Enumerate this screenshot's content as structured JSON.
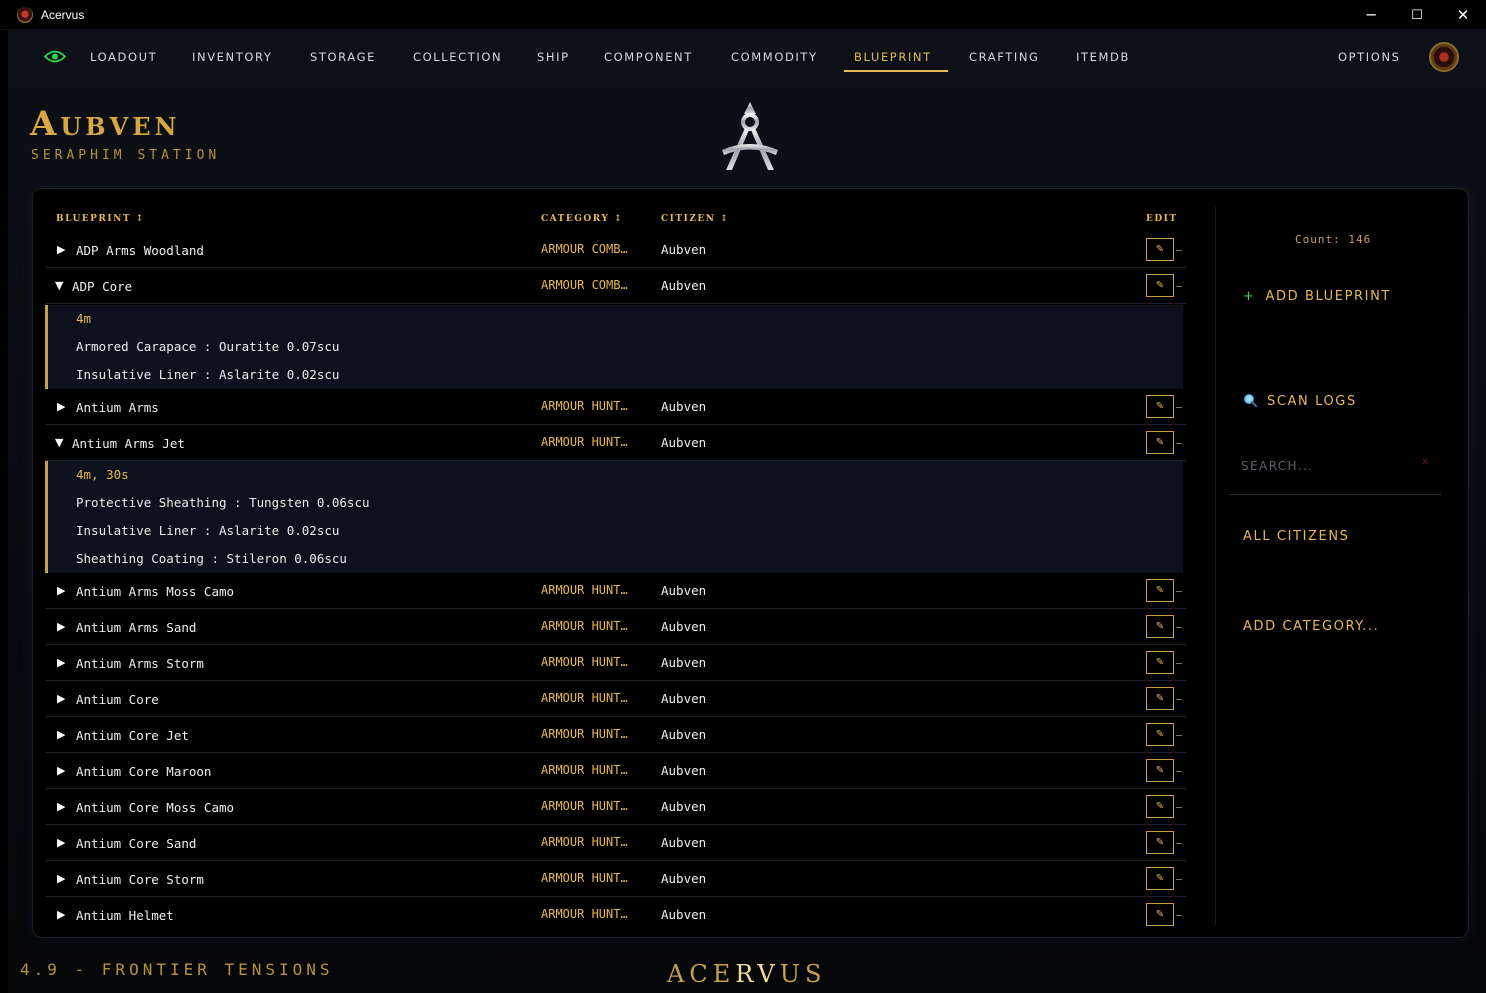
{
  "window": {
    "title": "Acervus",
    "minimize": "─",
    "maximize": "☐",
    "close": "✕"
  },
  "nav": {
    "items": [
      "LOADOUT",
      "INVENTORY",
      "STORAGE",
      "COLLECTION",
      "SHIP",
      "COMPONENT",
      "COMMODITY",
      "BLUEPRINT",
      "CRAFTING",
      "ITEMDB"
    ],
    "active": "BLUEPRINT",
    "options": "OPTIONS"
  },
  "header": {
    "citizen": "Aubven",
    "station": "SERAPHIM STATION"
  },
  "table": {
    "headers": {
      "blueprint": "BLUEPRINT ↕",
      "category": "CATEGORY ↕",
      "citizen": "CITIZEN ↕",
      "edit": "EDIT"
    },
    "rows": [
      {
        "name": "ADP Arms Woodland",
        "category": "ARMOUR COMBAT",
        "citizen": "Aubven",
        "expanded": false
      },
      {
        "name": "ADP Core",
        "category": "ARMOUR COMBAT",
        "citizen": "Aubven",
        "expanded": true,
        "details": {
          "time": "4m",
          "items": [
            "Armored Carapace : Ouratite 0.07scu",
            "Insulative Liner : Aslarite 0.02scu"
          ]
        }
      },
      {
        "name": "Antium Arms",
        "category": "ARMOUR HUNTER",
        "citizen": "Aubven",
        "expanded": false
      },
      {
        "name": "Antium Arms Jet",
        "category": "ARMOUR HUNTER",
        "citizen": "Aubven",
        "expanded": true,
        "details": {
          "time": "4m, 30s",
          "items": [
            "Protective Sheathing : Tungsten 0.06scu",
            "Insulative Liner : Aslarite 0.02scu",
            "Sheathing Coating : Stileron 0.06scu"
          ]
        }
      },
      {
        "name": "Antium Arms Moss Camo",
        "category": "ARMOUR HUNTER",
        "citizen": "Aubven",
        "expanded": false
      },
      {
        "name": "Antium Arms Sand",
        "category": "ARMOUR HUNTER",
        "citizen": "Aubven",
        "expanded": false
      },
      {
        "name": "Antium Arms Storm",
        "category": "ARMOUR HUNTER",
        "citizen": "Aubven",
        "expanded": false
      },
      {
        "name": "Antium Core",
        "category": "ARMOUR HUNTER",
        "citizen": "Aubven",
        "expanded": false
      },
      {
        "name": "Antium Core Jet",
        "category": "ARMOUR HUNTER",
        "citizen": "Aubven",
        "expanded": false
      },
      {
        "name": "Antium Core Maroon",
        "category": "ARMOUR HUNTER",
        "citizen": "Aubven",
        "expanded": false
      },
      {
        "name": "Antium Core Moss Camo",
        "category": "ARMOUR HUNTER",
        "citizen": "Aubven",
        "expanded": false
      },
      {
        "name": "Antium Core Sand",
        "category": "ARMOUR HUNTER",
        "citizen": "Aubven",
        "expanded": false
      },
      {
        "name": "Antium Core Storm",
        "category": "ARMOUR HUNTER",
        "citizen": "Aubven",
        "expanded": false
      },
      {
        "name": "Antium Helmet",
        "category": "ARMOUR HUNTER",
        "citizen": "Aubven",
        "expanded": false
      }
    ]
  },
  "sidebar": {
    "count": "Count: 146",
    "add_blueprint": "ADD BLUEPRINT",
    "scan_logs": "SCAN LOGS",
    "search_placeholder": "SEARCH...",
    "all_citizens": "ALL CITIZENS",
    "add_category": "ADD CATEGORY..."
  },
  "footer": {
    "version": "4.9 - FRONTIER TENSIONS",
    "logo": "ACERVUS"
  },
  "colors": {
    "accent": "#e6b950",
    "background": "#000000",
    "detail_bg": "#0b111d",
    "add_icon": "#3fd24a"
  },
  "icons": {
    "toggle_collapsed": "▶",
    "toggle_expanded": "▼",
    "edit": "✎",
    "add": "+",
    "clear": "✕"
  }
}
